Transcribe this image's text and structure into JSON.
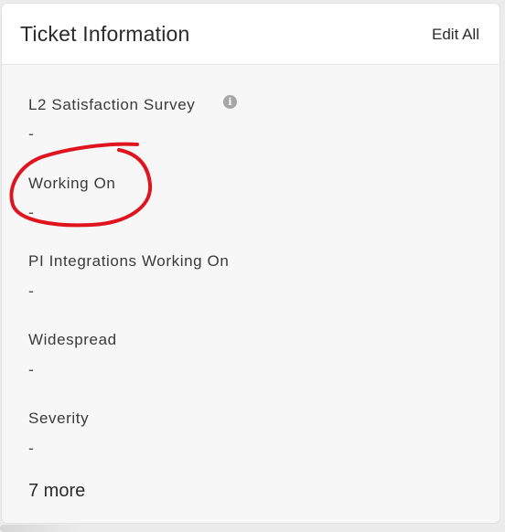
{
  "header": {
    "title": "Ticket Information",
    "edit_all_label": "Edit All"
  },
  "fields": [
    {
      "label": "L2 Satisfaction Survey",
      "value": "-",
      "info_icon": "info-icon"
    },
    {
      "label": "Working On",
      "value": "-"
    },
    {
      "label": "PI Integrations Working On",
      "value": "-"
    },
    {
      "label": "Widespread",
      "value": "-"
    },
    {
      "label": "Severity",
      "value": "-"
    }
  ],
  "more_link": "7 more",
  "annotation": {
    "shape": "hand-drawn circle",
    "color": "#e0141e",
    "target": "Working On"
  }
}
